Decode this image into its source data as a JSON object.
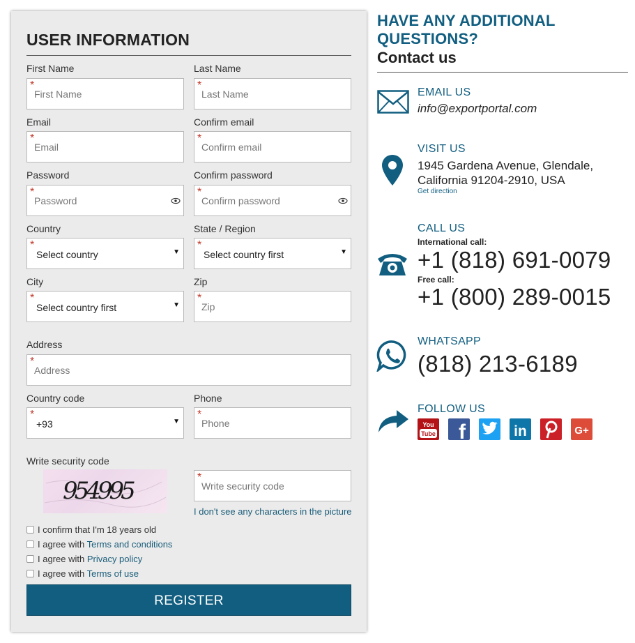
{
  "form": {
    "title": "USER INFORMATION",
    "first_name": {
      "label": "First Name",
      "placeholder": "First Name"
    },
    "last_name": {
      "label": "Last Name",
      "placeholder": "Last Name"
    },
    "email": {
      "label": "Email",
      "placeholder": "Email"
    },
    "confirm_email": {
      "label": "Confirm email",
      "placeholder": "Confirm email"
    },
    "password": {
      "label": "Password",
      "placeholder": "Password"
    },
    "confirm_password": {
      "label": "Confirm password",
      "placeholder": "Confirm password"
    },
    "country": {
      "label": "Country",
      "value": "Select country"
    },
    "state": {
      "label": "State / Region",
      "value": "Select country first"
    },
    "city": {
      "label": "City",
      "value": "Select country first"
    },
    "zip": {
      "label": "Zip",
      "placeholder": "Zip"
    },
    "address": {
      "label": "Address",
      "placeholder": "Address"
    },
    "country_code": {
      "label": "Country code",
      "value": "+93"
    },
    "phone": {
      "label": "Phone",
      "placeholder": "Phone"
    },
    "security": {
      "label": "Write security code",
      "placeholder": "Write security code",
      "captcha_text": "954995",
      "help_link": "I don't see any characters in the picture"
    },
    "checks": {
      "age": "I confirm that I'm 18 years old",
      "agree_prefix": "I agree with",
      "terms": "Terms and conditions",
      "privacy": "Privacy policy",
      "terms_of_use": "Terms of use"
    },
    "register_label": "REGISTER",
    "required_mark": "*"
  },
  "contact": {
    "title": "HAVE ANY ADDITIONAL QUESTIONS?",
    "subtitle": "Contact us",
    "email_head": "EMAIL US",
    "email": "info@exportportal.com",
    "visit_head": "VISIT US",
    "address_line1": "1945 Gardena Avenue, Glendale,",
    "address_line2": "California 91204-2910, USA",
    "direction": "Get direction",
    "call_head": "CALL US",
    "intl_label": "International call:",
    "intl_number": "+1 (818) 691-0079",
    "free_label": "Free call:",
    "free_number": "+1 (800) 289-0015",
    "whatsapp_head": "WHATSAPP",
    "whatsapp_number": "(818) 213-6189",
    "follow_head": "FOLLOW US",
    "social_text": {
      "youtube": "You Tube",
      "facebook": "f",
      "linkedin": "in",
      "googleplus": "G+"
    }
  },
  "colors": {
    "accent": "#115e80",
    "required": "#c0392b",
    "youtube": "#b31217",
    "facebook": "#3b5998",
    "twitter": "#1da1f2",
    "linkedin": "#0e76a8",
    "pinterest": "#cb2027",
    "googleplus": "#dd4b39"
  },
  "icons": [
    "mail-icon",
    "map-pin-icon",
    "phone-icon",
    "whatsapp-icon",
    "share-arrow-icon",
    "eye-icon",
    "caret-down-icon",
    "youtube-icon",
    "facebook-icon",
    "twitter-icon",
    "linkedin-icon",
    "pinterest-icon",
    "googleplus-icon"
  ]
}
